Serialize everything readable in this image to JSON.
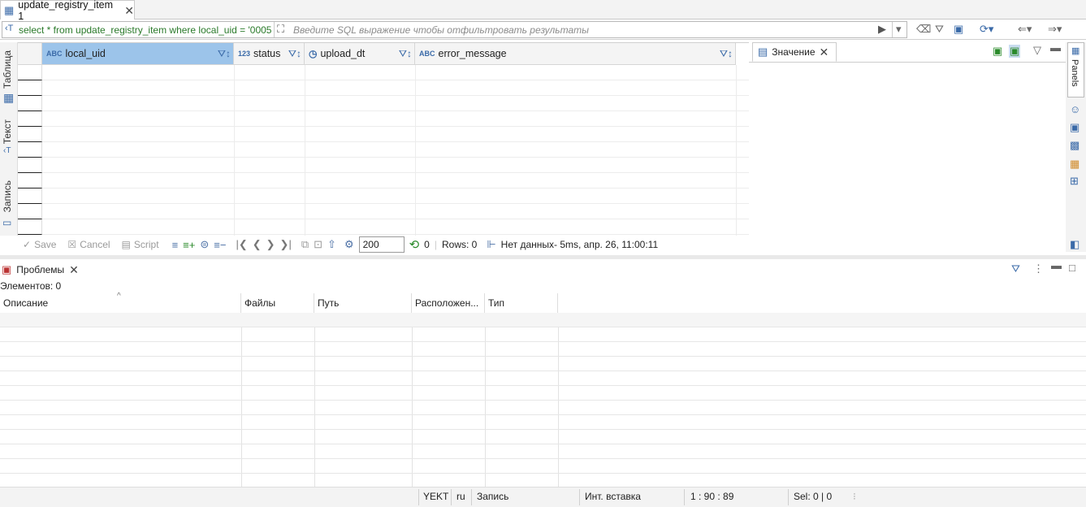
{
  "editor_tab": {
    "title": "update_registry_item 1"
  },
  "sql_bar": {
    "query": "select * from update_registry_item where local_uid = '0005",
    "filter_placeholder": "Введите SQL выражение чтобы отфильтровать результаты"
  },
  "left_tabs": {
    "table": "Таблица",
    "text": "Текст",
    "record": "Запись"
  },
  "columns": [
    {
      "name": "local_uid",
      "type_icon": "ABC",
      "selected": true
    },
    {
      "name": "status",
      "type_icon": "123",
      "selected": false
    },
    {
      "name": "upload_dt",
      "type_icon": "clock",
      "selected": false
    },
    {
      "name": "error_message",
      "type_icon": "ABC",
      "selected": false
    }
  ],
  "value_panel": {
    "tab": "Значение"
  },
  "right_bar": {
    "panels": "Panels"
  },
  "grid_toolbar": {
    "save": "Save",
    "cancel": "Cancel",
    "script": "Script",
    "fetch_size": "200",
    "refresh_count": "0",
    "rows": "Rows: 0",
    "status": "Нет данных- 5ms, апр. 26, 11:00:11"
  },
  "problems": {
    "tab": "Проблемы",
    "count": "Элементов: 0",
    "headers": [
      "Описание",
      "Файлы",
      "Путь",
      "Расположен...",
      "Тип"
    ]
  },
  "status_bar": {
    "tz": "YEKT",
    "lang": "ru",
    "mode": "Запись",
    "insert": "Инт. вставка",
    "pos": "1 : 90 : 89",
    "sel": "Sel: 0 | 0"
  },
  "colors": {
    "accent": "#3a6aa8",
    "selected_header": "#9cc4ea",
    "sql_text": "#2a7a2a"
  }
}
